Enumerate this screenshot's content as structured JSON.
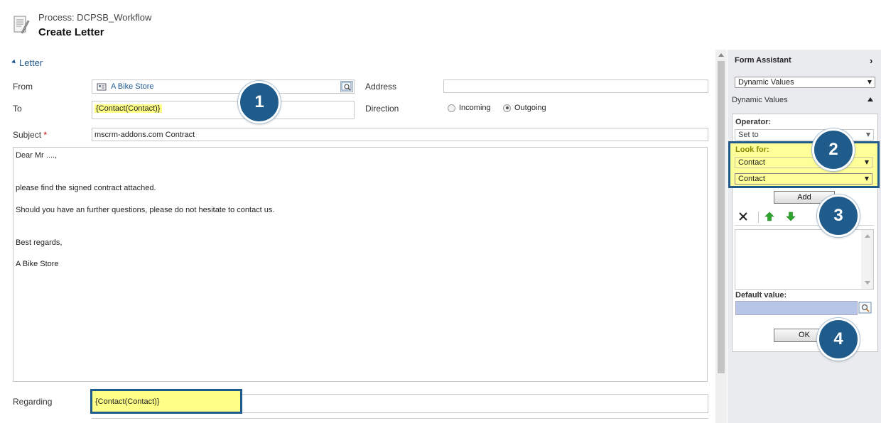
{
  "header": {
    "process_label": "Process: DCPSB_Workflow",
    "title": "Create Letter",
    "icon": "document-icon"
  },
  "section": {
    "label": "Letter"
  },
  "form": {
    "from_label": "From",
    "from_value": "A Bike Store",
    "to_label": "To",
    "to_value": "{Contact(Contact)}",
    "address_label": "Address",
    "address_value": "",
    "direction_label": "Direction",
    "direction_options": [
      "Incoming",
      "Outgoing"
    ],
    "direction_selected": "Outgoing",
    "subject_label": "Subject",
    "subject_required_mark": "*",
    "subject_value": "mscrm-addons.com Contract",
    "body_lines": [
      "Dear Mr ....,",
      "please find the signed contract attached.",
      "Should you have an further questions, please do not hesitate to contact us.",
      "Best regards,",
      "A Bike Store"
    ],
    "regarding_label": "Regarding",
    "regarding_value": "{Contact(Contact)}"
  },
  "callouts": [
    "1",
    "2",
    "3",
    "4"
  ],
  "form_assistant": {
    "title": "Form Assistant",
    "top_select": "Dynamic Values",
    "subsection": "Dynamic Values",
    "operator_label": "Operator:",
    "operator_value": "Set to",
    "look_for_label": "Look for:",
    "look_for_entity": "Contact",
    "look_for_field": "Contact",
    "add_button": "Add",
    "default_value_label": "Default value:",
    "ok_button": "OK"
  },
  "colors": {
    "highlight": "#ffff88",
    "callout": "#1f5c8b",
    "link": "#1f5a8f",
    "required": "#cc0000"
  }
}
